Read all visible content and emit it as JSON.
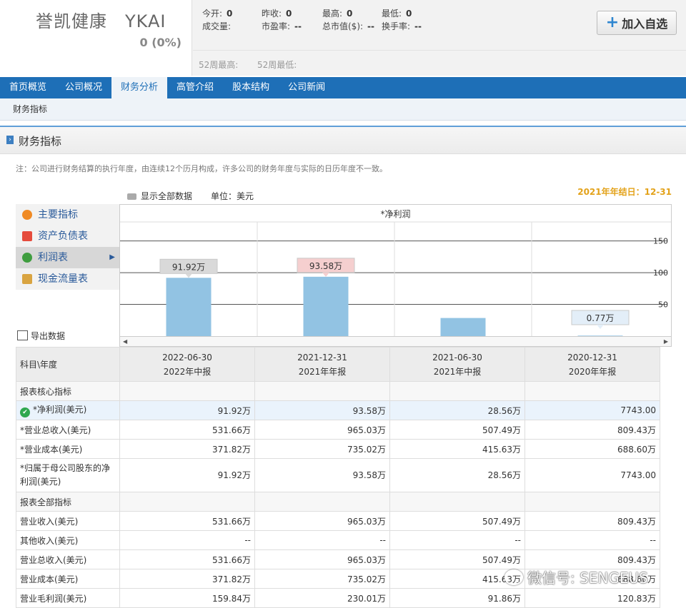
{
  "header": {
    "stock_name": "誉凯健康　YKAI",
    "change": "0 (0%)",
    "quotes": [
      {
        "label": "今开:",
        "value": "0"
      },
      {
        "label": "昨收:",
        "value": "0"
      },
      {
        "label": "最高:",
        "value": "0"
      },
      {
        "label": "最低:",
        "value": "0"
      },
      {
        "label": "成交量:",
        "value": ""
      },
      {
        "label": "市盈率:",
        "value": "--"
      },
      {
        "label": "总市值($):",
        "value": "--"
      },
      {
        "label": "换手率:",
        "value": "--"
      }
    ],
    "high52": "52周最高:",
    "low52": "52周最低:",
    "add_button": "加入自选"
  },
  "nav": {
    "items": [
      "首页概览",
      "公司概况",
      "财务分析",
      "高管介绍",
      "股本结构",
      "公司新闻"
    ],
    "active_index": 2,
    "sub": "财务指标"
  },
  "section": {
    "title": "财务指标",
    "note": "注：公司进行财务结算的执行年度，由连续12个历月构成，许多公司的财务年度与实际的日历年度不一致。",
    "show_all": "显示全部数据",
    "unit": "单位：美元",
    "fiscal_year_end": "2021年年结日：12-31"
  },
  "side_menu": {
    "items": [
      "主要指标",
      "资产负债表",
      "利润表",
      "现金流量表"
    ],
    "active_index": 2,
    "export": "导出数据"
  },
  "chart_data": {
    "type": "bar",
    "title": "*净利润",
    "categories": [
      "2022-06-30",
      "2021-12-31",
      "2021-06-30",
      "2020-12-31"
    ],
    "values": [
      91.92,
      93.58,
      28.56,
      0.7743
    ],
    "value_labels": [
      "91.92万",
      "93.58万",
      "",
      "0.77万"
    ],
    "label_colors": [
      "#d9d9d9",
      "#f5cfcf",
      "",
      "#e3eef8"
    ],
    "yticks": [
      "150",
      "100",
      "50"
    ],
    "ytick_values": [
      150,
      100,
      50
    ],
    "ylim": [
      0,
      180
    ],
    "bar_color": "#92c3e3",
    "grid": true
  },
  "table": {
    "corner": "科目\\年度",
    "columns": [
      {
        "date": "2022-06-30",
        "period": "2022年中报"
      },
      {
        "date": "2021-12-31",
        "period": "2021年年报"
      },
      {
        "date": "2021-06-30",
        "period": "2021年中报"
      },
      {
        "date": "2020-12-31",
        "period": "2020年年报"
      }
    ],
    "rows": [
      {
        "kind": "group",
        "label": "报表核心指标"
      },
      {
        "kind": "row",
        "label": "*净利润(美元)",
        "values": [
          "91.92万",
          "93.58万",
          "28.56万",
          "7743.00"
        ],
        "selected": true
      },
      {
        "kind": "row",
        "label": "*营业总收入(美元)",
        "values": [
          "531.66万",
          "965.03万",
          "507.49万",
          "809.43万"
        ]
      },
      {
        "kind": "row",
        "label": "*营业成本(美元)",
        "values": [
          "371.82万",
          "735.02万",
          "415.63万",
          "688.60万"
        ]
      },
      {
        "kind": "row",
        "label": "*归属于母公司股东的净利润(美元)",
        "values": [
          "91.92万",
          "93.58万",
          "28.56万",
          "7743.00"
        ],
        "tall": true
      },
      {
        "kind": "group",
        "label": "报表全部指标"
      },
      {
        "kind": "row",
        "label": "营业收入(美元)",
        "values": [
          "531.66万",
          "965.03万",
          "507.49万",
          "809.43万"
        ]
      },
      {
        "kind": "row",
        "label": "其他收入(美元)",
        "values": [
          "--",
          "--",
          "--",
          "--"
        ]
      },
      {
        "kind": "row",
        "label": "营业总收入(美元)",
        "values": [
          "531.66万",
          "965.03万",
          "507.49万",
          "809.43万"
        ]
      },
      {
        "kind": "row",
        "label": "营业成本(美元)",
        "values": [
          "371.82万",
          "735.02万",
          "415.63万",
          "688.60万"
        ]
      },
      {
        "kind": "row",
        "label": "营业毛利润(美元)",
        "values": [
          "159.84万",
          "230.01万",
          "91.86万",
          "120.83万"
        ]
      }
    ]
  },
  "watermark": "微信号: SENGEUS"
}
